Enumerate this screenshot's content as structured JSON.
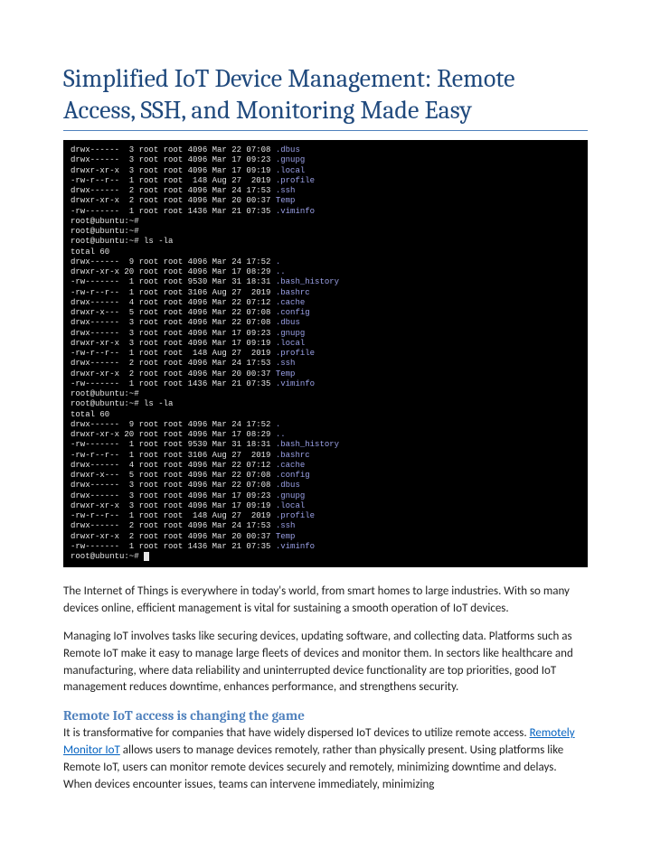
{
  "title": "Simplified IoT Device Management: Remote Access, SSH, and Monitoring Made Easy",
  "terminal": {
    "lines": [
      "drwx------  3 root root 4096 Mar 22 07:08 .dbus",
      "drwx------  3 root root 4096 Mar 17 09:23 .gnupg",
      "drwxr-xr-x  3 root root 4096 Mar 17 09:19 .local",
      "-rw-r--r--  1 root root  148 Aug 27  2019 .profile",
      "drwx------  2 root root 4096 Mar 24 17:53 .ssh",
      "drwxr-xr-x  2 root root 4096 Mar 20 00:37 Temp",
      "-rw-------  1 root root 1436 Mar 21 07:35 .viminfo",
      "root@ubuntu:~#",
      "root@ubuntu:~#",
      "root@ubuntu:~# ls -la",
      "total 60",
      "drwx------  9 root root 4096 Mar 24 17:52 .",
      "drwxr-xr-x 20 root root 4096 Mar 17 08:29 ..",
      "-rw-------  1 root root 9530 Mar 31 18:31 .bash_history",
      "-rw-r--r--  1 root root 3106 Aug 27  2019 .bashrc",
      "drwx------  4 root root 4096 Mar 22 07:12 .cache",
      "drwxr-x---  5 root root 4096 Mar 22 07:08 .config",
      "drwx------  3 root root 4096 Mar 22 07:08 .dbus",
      "drwx------  3 root root 4096 Mar 17 09:23 .gnupg",
      "drwxr-xr-x  3 root root 4096 Mar 17 09:19 .local",
      "-rw-r--r--  1 root root  148 Aug 27  2019 .profile",
      "drwx------  2 root root 4096 Mar 24 17:53 .ssh",
      "drwxr-xr-x  2 root root 4096 Mar 20 00:37 Temp",
      "-rw-------  1 root root 1436 Mar 21 07:35 .viminfo",
      "root@ubuntu:~#",
      "root@ubuntu:~# ls -la",
      "total 60",
      "drwx------  9 root root 4096 Mar 24 17:52 .",
      "drwxr-xr-x 20 root root 4096 Mar 17 08:29 ..",
      "-rw-------  1 root root 9530 Mar 31 18:31 .bash_history",
      "-rw-r--r--  1 root root 3106 Aug 27  2019 .bashrc",
      "drwx------  4 root root 4096 Mar 22 07:12 .cache",
      "drwxr-x---  5 root root 4096 Mar 22 07:08 .config",
      "drwx------  3 root root 4096 Mar 22 07:08 .dbus",
      "drwx------  3 root root 4096 Mar 17 09:23 .gnupg",
      "drwxr-xr-x  3 root root 4096 Mar 17 09:19 .local",
      "-rw-r--r--  1 root root  148 Aug 27  2019 .profile",
      "drwx------  2 root root 4096 Mar 24 17:53 .ssh",
      "drwxr-xr-x  2 root root 4096 Mar 20 00:37 Temp",
      "-rw-------  1 root root 1436 Mar 21 07:35 .viminfo",
      "root@ubuntu:~# "
    ]
  },
  "para1": "The Internet of Things is everywhere in today's world, from smart homes to large industries. With so many devices online, efficient management is vital for sustaining a smooth operation of IoT devices.",
  "para2": "Managing IoT involves tasks like securing devices, updating software, and collecting data. Platforms such as Remote IoT make it easy to manage large fleets of devices and monitor them. In sectors like healthcare and manufacturing, where data reliability and uninterrupted device functionality are top priorities, good IoT management reduces downtime, enhances performance, and strengthens security.",
  "section_heading": "Remote IoT access is changing the game",
  "para3_pre": "It is transformative for companies that have widely dispersed IoT devices to utilize remote access. ",
  "link_text": "Remotely Monitor IoT",
  "para3_post": " allows users to manage devices remotely, rather than physically present. Using platforms like Remote IoT, users can monitor remote devices securely and remotely, minimizing downtime and delays. When devices encounter issues, teams can intervene immediately, minimizing"
}
